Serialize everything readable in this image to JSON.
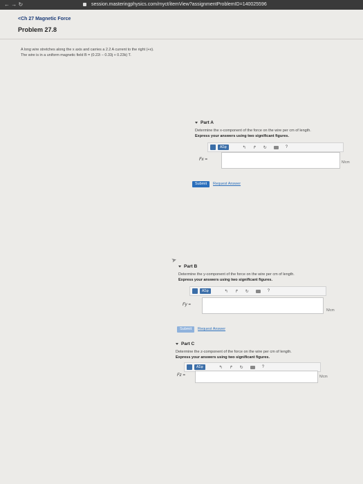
{
  "browser": {
    "url": "session.masteringphysics.com/myct/itemView?assignmentProblemID=140025596",
    "nav_icons": "← → ↻"
  },
  "page": {
    "breadcrumb": "<Ch 27 Magnetic Force",
    "problem_title": "Problem 27.8",
    "problem_text": "A long wire stretches along the x axis and carries a 2.2 A current to the right (+x). The wire is in a uniform magnetic field B = (0.22i − 0.33j + 0.23k) T."
  },
  "toolbar": {
    "template_label": "□√□",
    "greek_label": "AΣφ",
    "undo": "↰",
    "redo": "↱",
    "reset": "↻",
    "help": "?"
  },
  "parts": [
    {
      "header": "Part A",
      "instruction": "Determine the x-component of the force on the wire per cm of length.",
      "emphasis": "Express your answers using two significant figures.",
      "label": "Fx =",
      "units": "N/cm",
      "submit": "Submit",
      "request": "Request Answer"
    },
    {
      "header": "Part B",
      "instruction": "Determine the y-component of the force on the wire per cm of length.",
      "emphasis": "Express your answers using two significant figures.",
      "label": "Fy =",
      "units": "N/cm",
      "submit": "Submit",
      "request": "Request Answer"
    },
    {
      "header": "Part C",
      "instruction": "Determine the z-component of the force on the wire per cm of length.",
      "emphasis": "Express your answers using two significant figures.",
      "label": "Fz =",
      "units": "N/cm"
    }
  ],
  "colors": {
    "accent": "#2a6ebb",
    "page_bg": "#ecebe8"
  }
}
